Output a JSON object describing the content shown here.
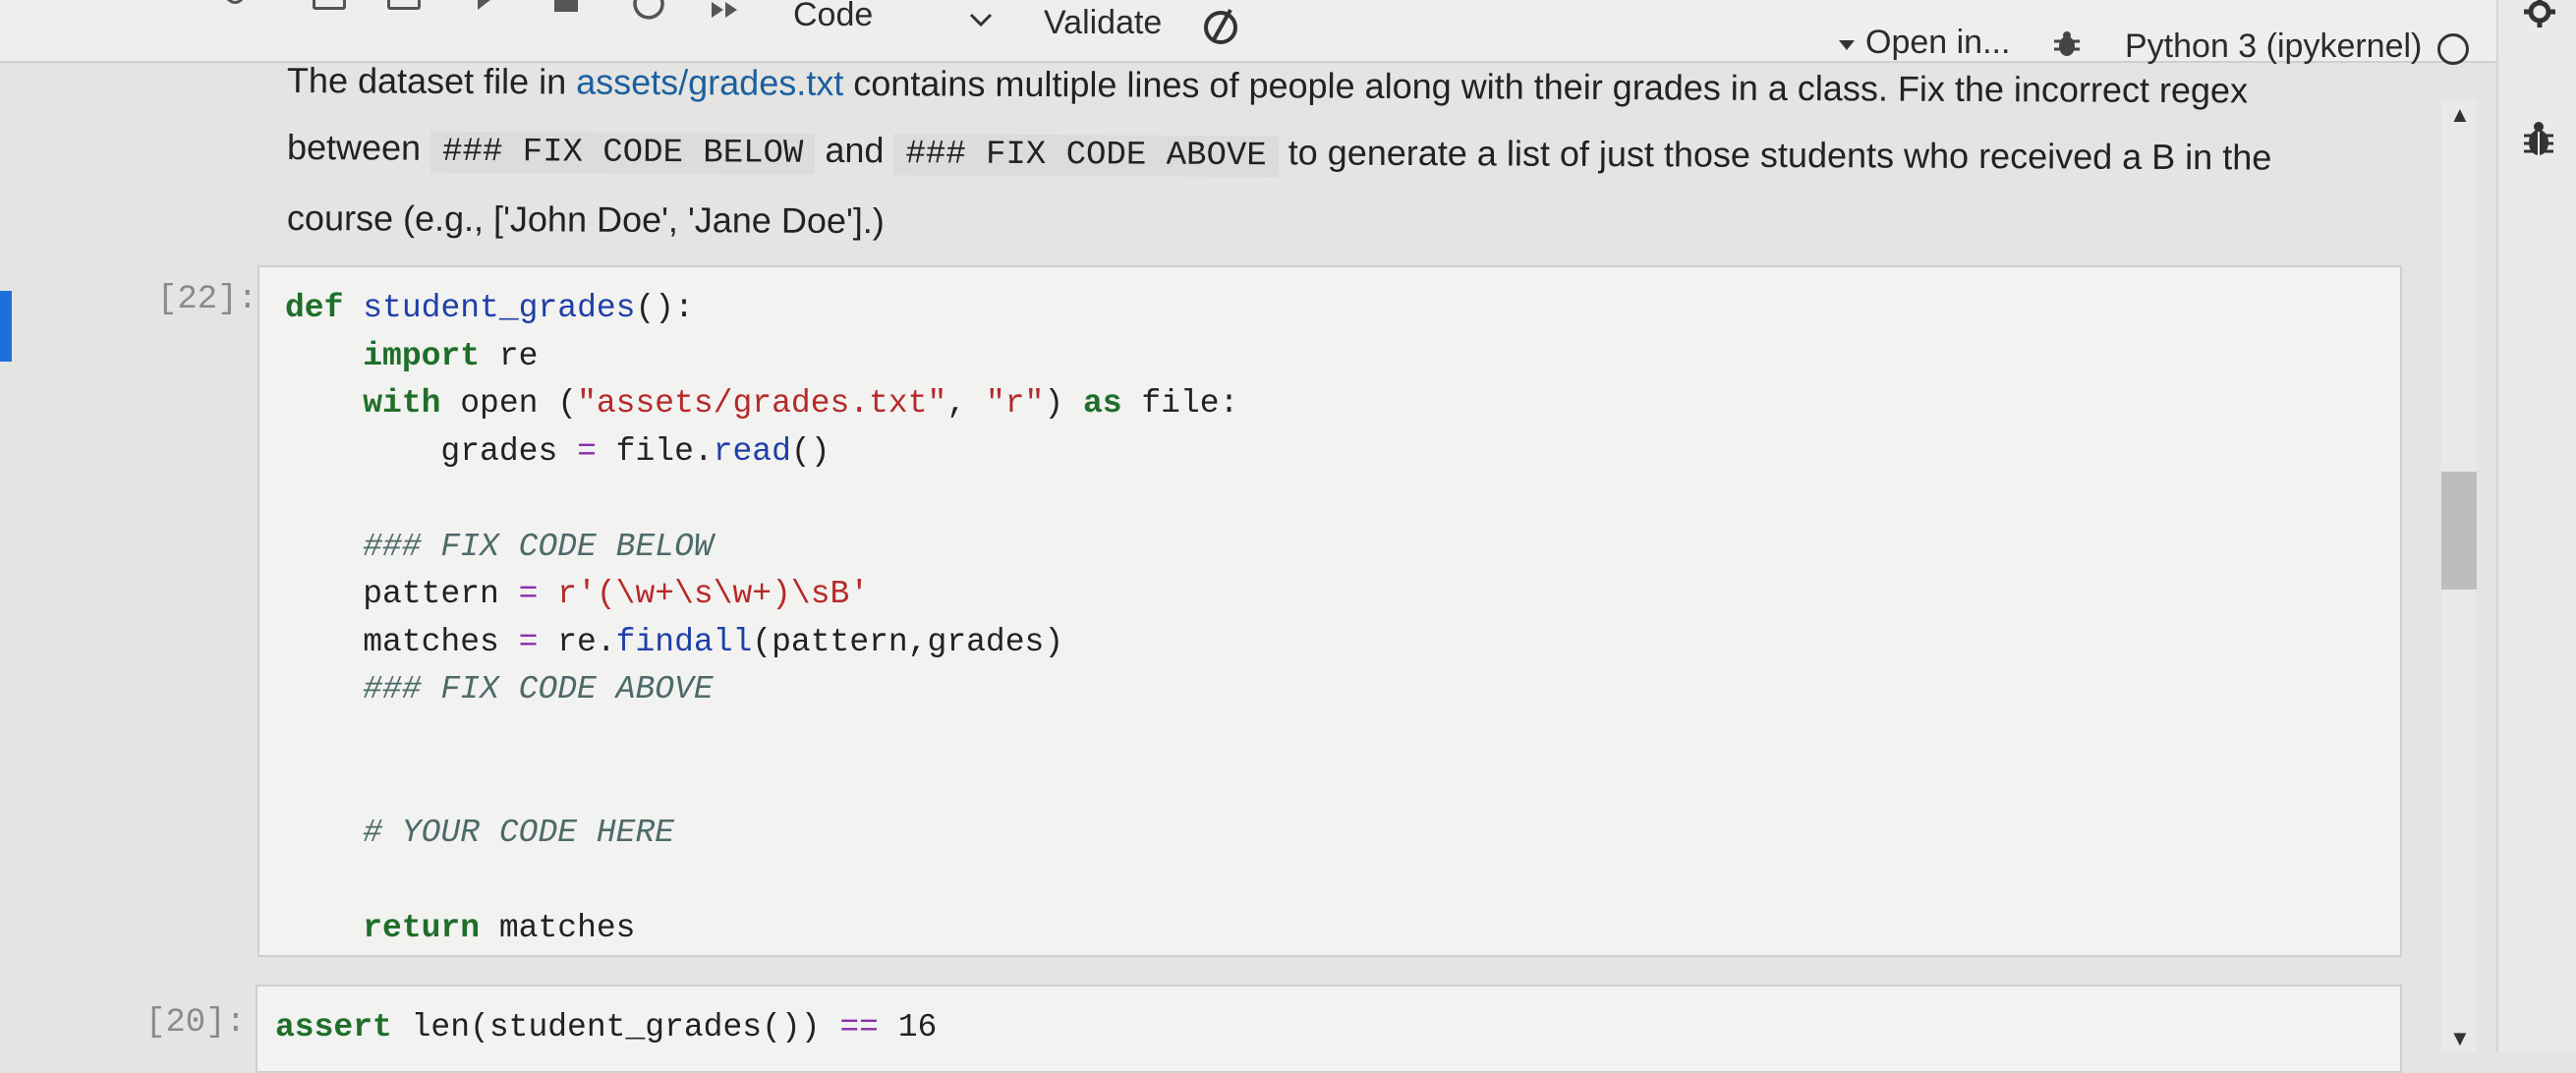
{
  "toolbar": {
    "cell_type": "Code",
    "validate_label": "Validate",
    "open_in_label": "Open in...",
    "kernel_label": "Python 3 (ipykernel)"
  },
  "markdown": {
    "line1_a": "The dataset file in ",
    "line1_link": "assets/grades.txt",
    "line1_b": " contains multiple lines of people along with their grades in a class. Fix the incorrect regex",
    "line2_a": "between ",
    "line2_code1": "### FIX CODE BELOW",
    "line2_b": " and ",
    "line2_code2": "### FIX CODE ABOVE",
    "line2_c": " to generate a list of just those students who received a B in the",
    "line3": "course (e.g., ['John Doe', 'Jane Doe'].)"
  },
  "cells": [
    {
      "prompt": "[22]:",
      "lines": [
        [
          {
            "t": "kw",
            "v": "def"
          },
          {
            "t": "",
            "v": " "
          },
          {
            "t": "fn",
            "v": "student_grades"
          },
          {
            "t": "",
            "v": "():"
          }
        ],
        [
          {
            "t": "",
            "v": "    "
          },
          {
            "t": "kw",
            "v": "import"
          },
          {
            "t": "",
            "v": " re"
          }
        ],
        [
          {
            "t": "",
            "v": "    "
          },
          {
            "t": "kw",
            "v": "with"
          },
          {
            "t": "",
            "v": " open ("
          },
          {
            "t": "str",
            "v": "\"assets/grades.txt\""
          },
          {
            "t": "",
            "v": ", "
          },
          {
            "t": "str",
            "v": "\"r\""
          },
          {
            "t": "",
            "v": ") "
          },
          {
            "t": "kw",
            "v": "as"
          },
          {
            "t": "",
            "v": " file:"
          }
        ],
        [
          {
            "t": "",
            "v": "        grades "
          },
          {
            "t": "op",
            "v": "="
          },
          {
            "t": "",
            "v": " file."
          },
          {
            "t": "fn",
            "v": "read"
          },
          {
            "t": "",
            "v": "()"
          }
        ],
        [
          {
            "t": "",
            "v": ""
          }
        ],
        [
          {
            "t": "",
            "v": "    "
          },
          {
            "t": "cm",
            "v": "### FIX CODE BELOW"
          }
        ],
        [
          {
            "t": "",
            "v": "    pattern "
          },
          {
            "t": "op",
            "v": "="
          },
          {
            "t": "",
            "v": " "
          },
          {
            "t": "str",
            "v": "r'(\\w+\\s\\w+)\\sB'"
          }
        ],
        [
          {
            "t": "",
            "v": "    matches "
          },
          {
            "t": "op",
            "v": "="
          },
          {
            "t": "",
            "v": " re."
          },
          {
            "t": "fn",
            "v": "findall"
          },
          {
            "t": "",
            "v": "(pattern,grades)"
          }
        ],
        [
          {
            "t": "",
            "v": "    "
          },
          {
            "t": "cm",
            "v": "### FIX CODE ABOVE"
          }
        ],
        [
          {
            "t": "",
            "v": ""
          }
        ],
        [
          {
            "t": "",
            "v": ""
          }
        ],
        [
          {
            "t": "",
            "v": "    "
          },
          {
            "t": "cm",
            "v": "# YOUR CODE HERE"
          }
        ],
        [
          {
            "t": "",
            "v": ""
          }
        ],
        [
          {
            "t": "",
            "v": "    "
          },
          {
            "t": "kw",
            "v": "return"
          },
          {
            "t": "",
            "v": " matches"
          }
        ]
      ]
    },
    {
      "prompt": "[20]:",
      "lines": [
        [
          {
            "t": "kw",
            "v": "assert"
          },
          {
            "t": "",
            "v": " len(student_grades()) "
          },
          {
            "t": "op",
            "v": "=="
          },
          {
            "t": "",
            "v": " 16"
          }
        ]
      ]
    }
  ],
  "icons": [
    "cut-icon",
    "copy-icon",
    "paste-icon",
    "run-icon",
    "stop-icon",
    "restart-icon",
    "fast-forward-icon",
    "chevron-down-icon",
    "validate-icon",
    "caret-down-icon",
    "bug-icon",
    "kernel-status-icon",
    "settings-gear-icon",
    "debugger-icon",
    "scroll-up-icon",
    "scroll-down-icon"
  ]
}
